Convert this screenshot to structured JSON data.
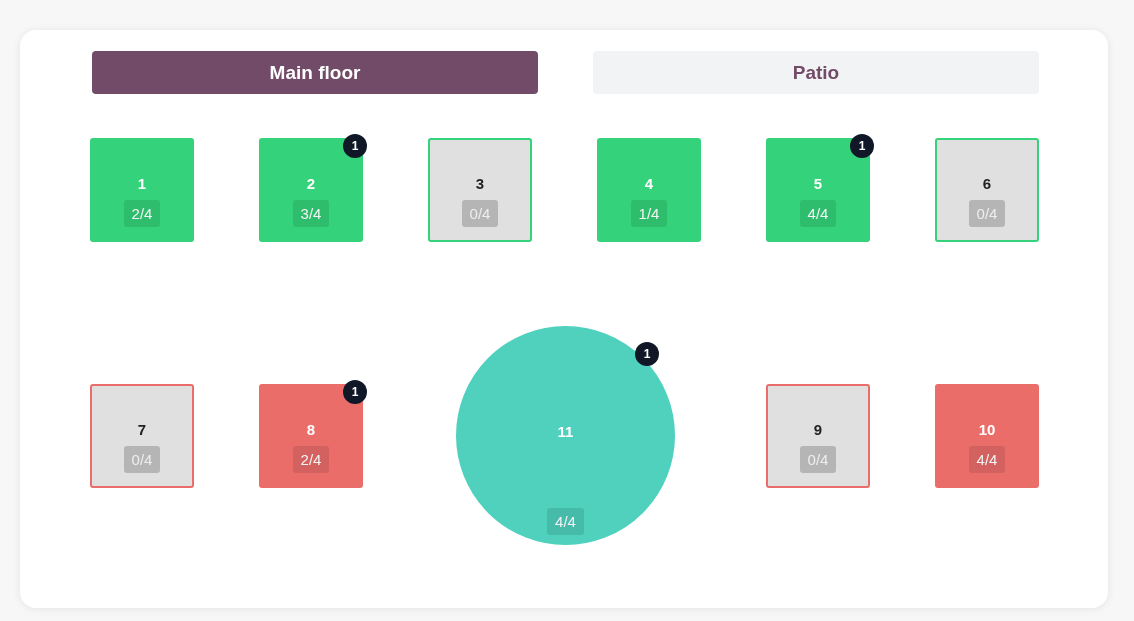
{
  "tabs": [
    {
      "label": "Main floor",
      "selected": true
    },
    {
      "label": "Patio",
      "selected": false
    }
  ],
  "floor": {
    "rows": [
      {
        "tables": [
          {
            "number": "1",
            "seats": "2/4",
            "kind": "square",
            "occupied": true,
            "color": "#34d27a"
          },
          {
            "number": "2",
            "seats": "3/4",
            "kind": "square",
            "occupied": true,
            "color": "#34d27a",
            "badge": "1"
          },
          {
            "number": "3",
            "seats": "0/4",
            "kind": "square",
            "occupied": false,
            "color": "#34d27a"
          },
          {
            "number": "4",
            "seats": "1/4",
            "kind": "square",
            "occupied": true,
            "color": "#34d27a"
          },
          {
            "number": "5",
            "seats": "4/4",
            "kind": "square",
            "occupied": true,
            "color": "#34d27a",
            "badge": "1"
          },
          {
            "number": "6",
            "seats": "0/4",
            "kind": "square",
            "occupied": false,
            "color": "#34d27a"
          }
        ]
      },
      {
        "tables": [
          {
            "number": "7",
            "seats": "0/4",
            "kind": "square",
            "occupied": false,
            "color": "#eb6d6a"
          },
          {
            "number": "8",
            "seats": "2/4",
            "kind": "square",
            "occupied": true,
            "color": "#eb6d6a",
            "badge": "1"
          },
          {
            "number": "11",
            "seats": "4/4",
            "kind": "round",
            "occupied": true,
            "color": "#4fd1be",
            "badge": "1"
          },
          {
            "number": "9",
            "seats": "0/4",
            "kind": "square",
            "occupied": false,
            "color": "#eb6d6a"
          },
          {
            "number": "10",
            "seats": "4/4",
            "kind": "square",
            "occupied": true,
            "color": "#eb6d6a"
          }
        ]
      }
    ]
  }
}
